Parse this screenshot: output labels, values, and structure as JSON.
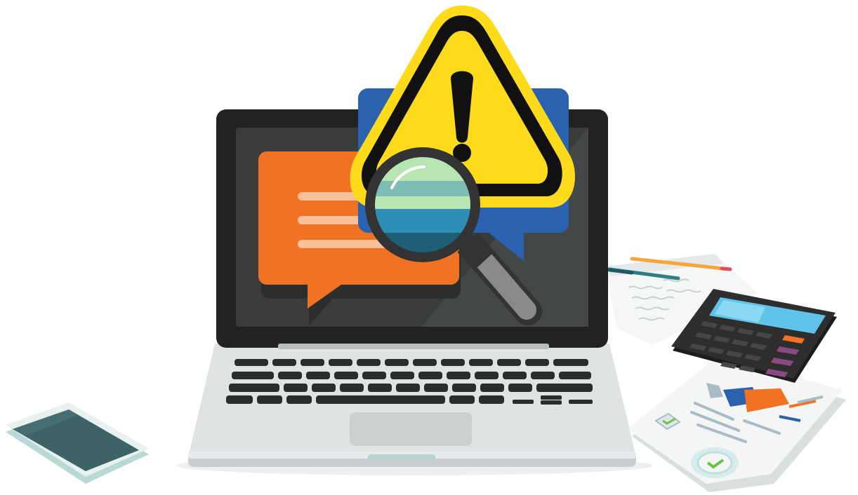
{
  "scene": {
    "subject": "laptop-with-warning-and-magnifier",
    "icons": [
      "warning-icon",
      "magnifier-icon",
      "chat-bubble-icon",
      "calculator-icon",
      "smartphone-icon",
      "pencil-icon",
      "pen-icon",
      "report-document-icon",
      "checkbox-icon",
      "badge-icon"
    ]
  },
  "colors": {
    "background": "#ffffff",
    "laptop_bezel": "#222222",
    "laptop_screen": "#3a3c3c",
    "laptop_body": "#dfe3e3",
    "laptop_keys": "#2a2d2e",
    "chat_orange": "#f27223",
    "chat_blue": "#2a62b0",
    "warning_yellow": "#fddb1b",
    "warning_black": "#111111",
    "lens_green": "#b8e6b2",
    "lens_teal": "#2e8db3",
    "magnifier_handle": "#8a8a8a",
    "calculator_body": "#2e2e2e",
    "calculator_screen": "#5fc3ea",
    "phone_screen": "#3d6367",
    "pencil_orange": "#f5a53a",
    "pen_teal": "#2d7f86",
    "chart_blue": "#2a62b0",
    "chart_orange": "#f27223",
    "check_green": "#6dc14b"
  }
}
